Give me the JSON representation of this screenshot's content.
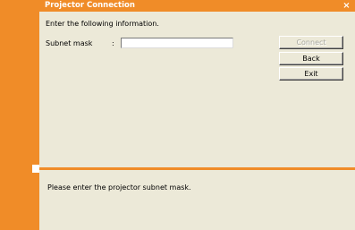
{
  "window": {
    "title": "Projector Connection",
    "close_glyph": "×",
    "accent_color": "#f08c28"
  },
  "form": {
    "instruction": "Enter the following information.",
    "subnet_label": "Subnet mask",
    "colon": ":",
    "subnet_value": ""
  },
  "buttons": {
    "connect": "Connect",
    "back": "Back",
    "exit": "Exit"
  },
  "message": {
    "text": "Please enter the projector subnet mask."
  }
}
